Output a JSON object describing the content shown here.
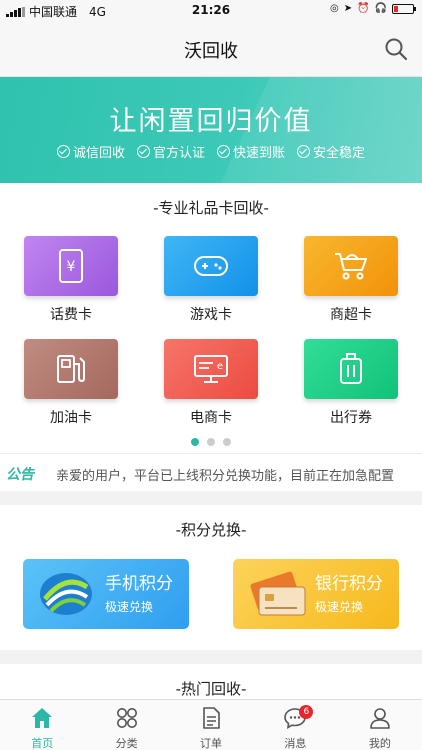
{
  "status_bar": {
    "carrier": "中国联通",
    "network": "4G",
    "time": "21:26"
  },
  "nav": {
    "title": "沃回收"
  },
  "banner": {
    "headline": "让闲置回归价值",
    "tags": [
      "诚信回收",
      "官方认证",
      "快速到账",
      "安全稳定"
    ]
  },
  "gift_section": {
    "title": "-专业礼品卡回收-",
    "items": [
      {
        "label": "话费卡",
        "icon": "phone-card-icon",
        "color": "#b06ee6"
      },
      {
        "label": "游戏卡",
        "icon": "gamepad-icon",
        "color": "#1fa1f0"
      },
      {
        "label": "商超卡",
        "icon": "shopping-cart-icon",
        "color": "#f5a418"
      },
      {
        "label": "加油卡",
        "icon": "fuel-pump-icon",
        "color": "#b87a6f"
      },
      {
        "label": "电商卡",
        "icon": "monitor-icon",
        "color": "#f05f55"
      },
      {
        "label": "出行券",
        "icon": "luggage-icon",
        "color": "#24d08a"
      }
    ],
    "page_count": 3,
    "active_page": 1
  },
  "notice": {
    "badge": "公告",
    "text": "亲爱的用户，平台已上线积分兑换功能，目前正在加急配置"
  },
  "points_section": {
    "title": "-积分兑换-",
    "cards": [
      {
        "title": "手机积分",
        "subtitle": "极速兑换",
        "icon": "china-mobile-logo-icon"
      },
      {
        "title": "银行积分",
        "subtitle": "极速兑换",
        "icon": "bank-card-icon"
      }
    ]
  },
  "hot_section": {
    "title": "-热门回收-"
  },
  "tabbar": {
    "tabs": [
      {
        "label": "首页",
        "icon": "home-icon",
        "active": true
      },
      {
        "label": "分类",
        "icon": "category-grid-icon",
        "active": false
      },
      {
        "label": "订单",
        "icon": "order-document-icon",
        "active": false
      },
      {
        "label": "消息",
        "icon": "message-bubble-icon",
        "active": false,
        "badge": "6"
      },
      {
        "label": "我的",
        "icon": "user-profile-icon",
        "active": false
      }
    ]
  },
  "colors": {
    "accent": "#2db7a6",
    "badge_red": "#e8262d"
  }
}
